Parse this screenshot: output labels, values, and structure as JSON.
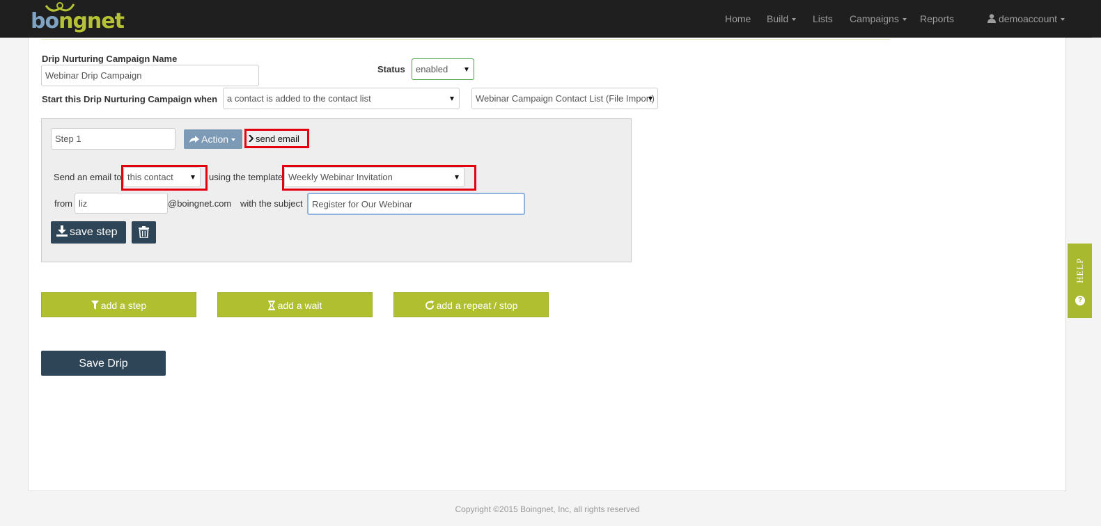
{
  "brand": {
    "logo_text_a": "bo",
    "logo_text_b": "ngnet"
  },
  "nav": {
    "home": "Home",
    "build": "Build",
    "lists": "Lists",
    "campaigns": "Campaigns",
    "reports": "Reports",
    "account": "demoaccount"
  },
  "form": {
    "name_label": "Drip Nurturing Campaign Name",
    "name_value": "Webinar Drip Campaign",
    "status_label": "Status",
    "status_value": "enabled",
    "start_label": "Start this Drip Nurturing Campaign when",
    "trigger_value": "a contact is added to the contact list",
    "list_value": "Webinar Campaign Contact List (File Import)"
  },
  "step": {
    "name_value": "Step 1",
    "action_label": "Action",
    "action_type": "send email",
    "send_to_label": "Send an email to",
    "recipient_value": "this contact",
    "template_label": "using the template",
    "template_value": "Weekly Webinar Invitation",
    "from_label": "from",
    "from_value": "liz",
    "domain": "@boingnet.com",
    "subject_label": "with the subject",
    "subject_value": "Register for Our Webinar",
    "save_label": "save step"
  },
  "actions": {
    "add_step": "add a step",
    "add_wait": "add a wait",
    "add_repeat": "add a repeat / stop",
    "save_drip": "Save Drip"
  },
  "help": {
    "label": "HELP",
    "icon": "?"
  },
  "footer": {
    "copyright": "Copyright ©2015 Boingnet, Inc, all rights reserved"
  },
  "colors": {
    "accent_green": "#b0bf30",
    "dark_button": "#2e4558",
    "action_button": "#7c9ab6",
    "highlight_red": "#e3000f",
    "navbar": "#1f1f1f"
  },
  "icons": [
    "user-icon",
    "share-icon",
    "chevron-right-icon",
    "download-icon",
    "trash-icon",
    "filter-icon",
    "hourglass-icon",
    "refresh-icon",
    "question-circle-icon"
  ]
}
